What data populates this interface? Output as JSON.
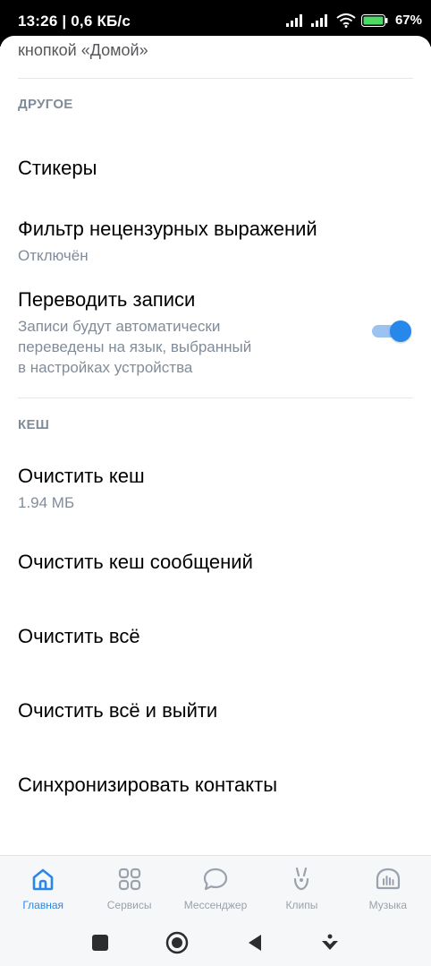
{
  "status_bar": {
    "time": "13:26 | 0,6 КБ/с",
    "battery": "67%"
  },
  "content": {
    "cut_text": "кнопкой «Домой»",
    "sections": {
      "other": {
        "title": "ДРУГОЕ",
        "stickers": "Стикеры",
        "filter_title": "Фильтр нецензурных выражений",
        "filter_status": "Отключён",
        "translate_title": "Переводить записи",
        "translate_desc_1": "Записи будут автоматически",
        "translate_desc_2": "переведены на язык, выбранный",
        "translate_desc_3": "в настройках устройства",
        "translate_enabled": true
      },
      "cache": {
        "title": "КЕШ",
        "clear_cache": "Очистить кеш",
        "cache_size": "1.94 МБ",
        "clear_messages_cache": "Очистить кеш сообщений",
        "clear_all": "Очистить всё",
        "clear_all_logout": "Очистить всё и выйти",
        "sync_contacts": "Синхронизировать контакты"
      }
    }
  },
  "tabbar": {
    "home": "Главная",
    "services": "Сервисы",
    "messenger": "Мессенджер",
    "clips": "Клипы",
    "music": "Музыка"
  },
  "colors": {
    "accent": "#2688eb",
    "secondary_text": "#818c99",
    "tab_inactive": "#99a2ad"
  }
}
